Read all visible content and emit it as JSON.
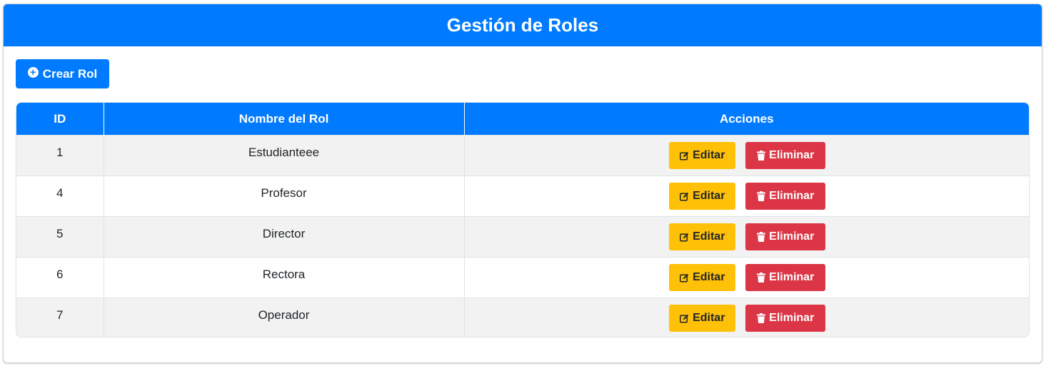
{
  "header": {
    "title": "Gestión de Roles"
  },
  "toolbar": {
    "create_label": "Crear Rol",
    "create_icon": "plus-circle-icon"
  },
  "table": {
    "columns": [
      "ID",
      "Nombre del Rol",
      "Acciones"
    ],
    "rows": [
      {
        "id": "1",
        "name": "Estudianteee"
      },
      {
        "id": "4",
        "name": "Profesor"
      },
      {
        "id": "5",
        "name": "Director"
      },
      {
        "id": "6",
        "name": "Rectora"
      },
      {
        "id": "7",
        "name": "Operador"
      }
    ],
    "edit_label": "Editar",
    "delete_label": "Eliminar",
    "edit_icon": "edit-icon",
    "delete_icon": "trash-icon"
  },
  "colors": {
    "primary": "#007bff",
    "warning": "#ffc107",
    "danger": "#dc3545"
  }
}
